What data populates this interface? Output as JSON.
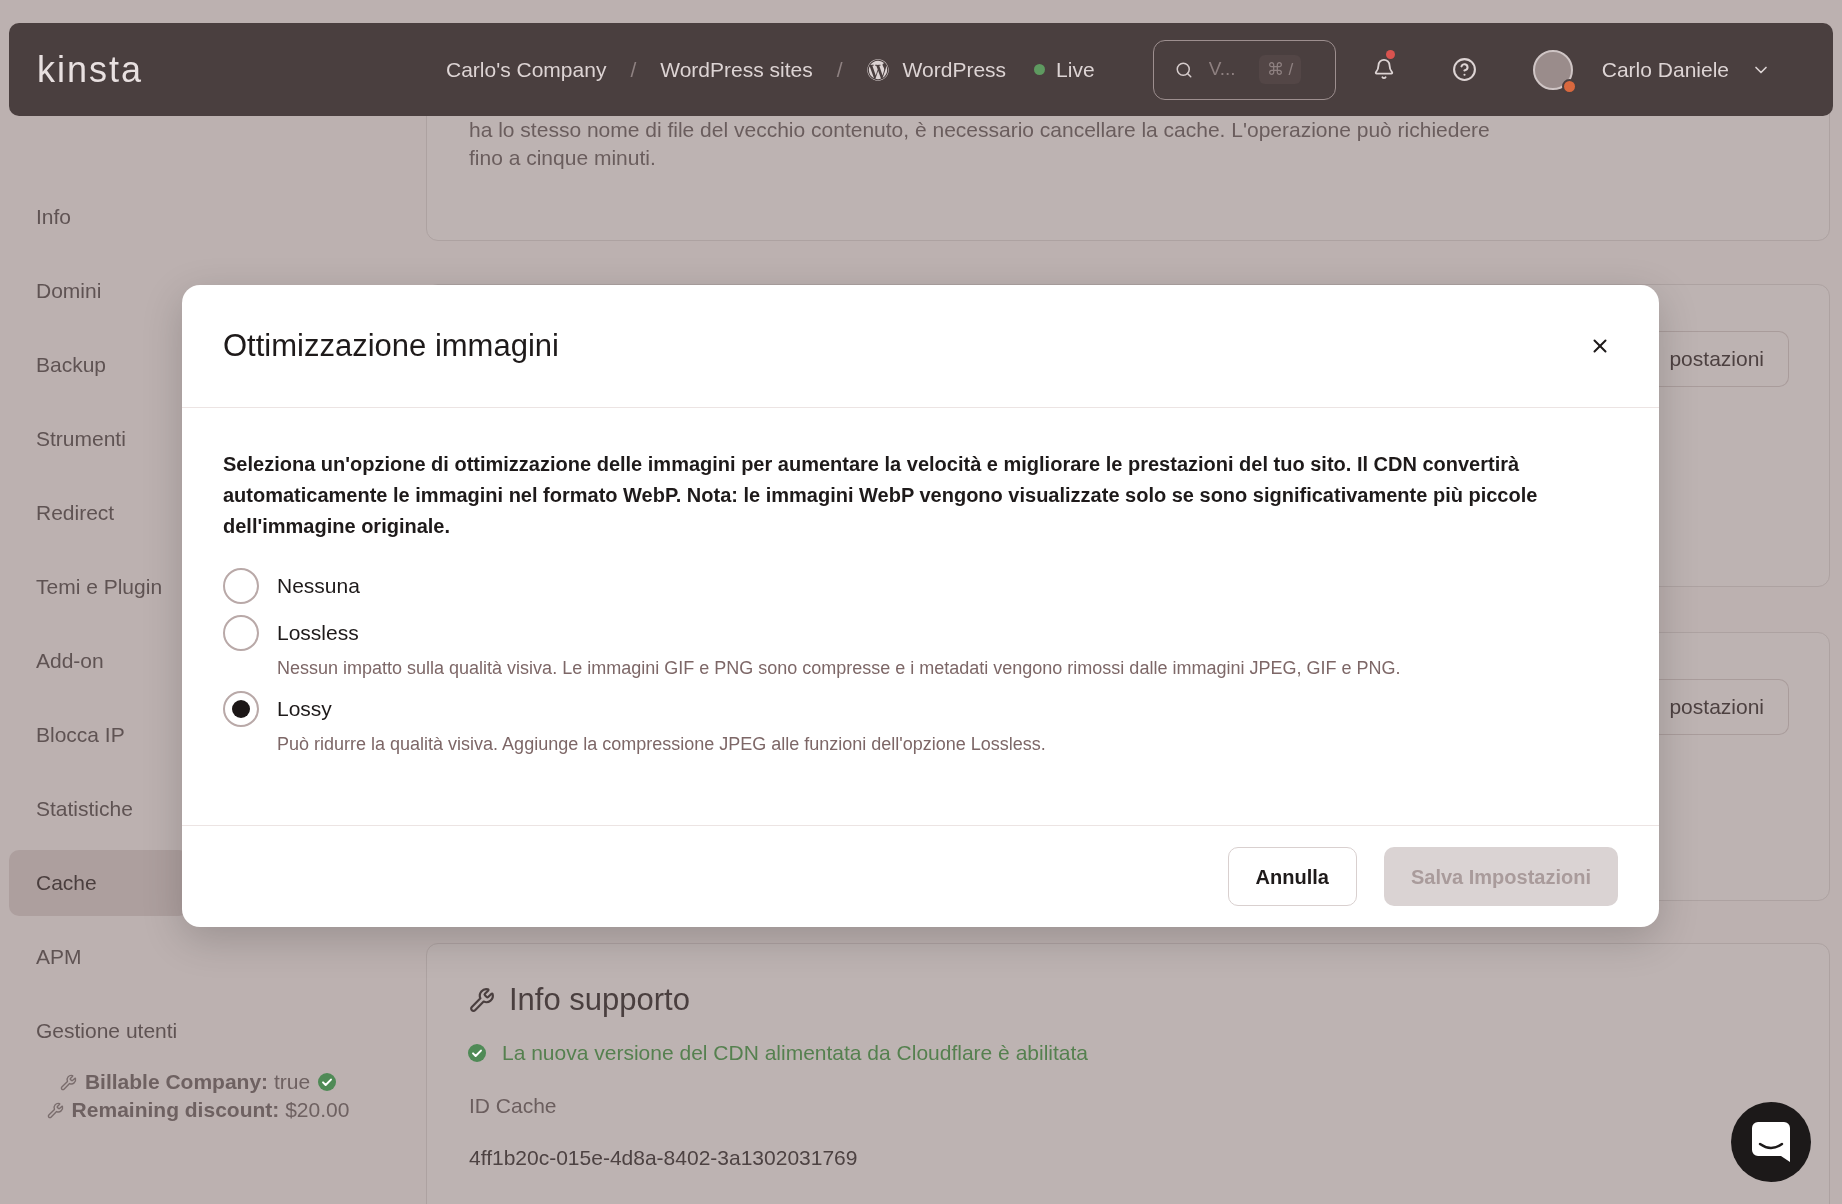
{
  "topbar": {
    "logo": "kinsta",
    "breadcrumbs": [
      {
        "kind": "link",
        "text": "Carlo's Company"
      },
      {
        "kind": "separator",
        "text": "/"
      },
      {
        "kind": "link",
        "text": "WordPress sites"
      },
      {
        "kind": "separator",
        "text": "/"
      },
      {
        "kind": "site",
        "text": "WordPress"
      }
    ],
    "status": {
      "label": "Live",
      "online": true
    },
    "search": {
      "placeholder": "V...",
      "shortcut": "⌘ /"
    },
    "notifications": {
      "unread": true
    },
    "user": {
      "name": "Carlo Daniele"
    }
  },
  "sidebar": {
    "items": [
      {
        "label": "Info",
        "selected": false
      },
      {
        "label": "Domini",
        "selected": false
      },
      {
        "label": "Backup",
        "selected": false
      },
      {
        "label": "Strumenti",
        "selected": false
      },
      {
        "label": "Redirect",
        "selected": false
      },
      {
        "label": "Temi e Plugin",
        "selected": false
      },
      {
        "label": "Add-on",
        "selected": false
      },
      {
        "label": "Blocca IP",
        "selected": false
      },
      {
        "label": "Statistiche",
        "selected": false
      },
      {
        "label": "Cache",
        "selected": true
      },
      {
        "label": "APM",
        "selected": false
      },
      {
        "label": "Gestione utenti",
        "selected": false
      }
    ],
    "meta": [
      {
        "text": "**Billable Company:** true",
        "verified": true
      },
      {
        "text": "**Remaining discount:** $20.00"
      }
    ]
  },
  "content": {
    "notice": {
      "lines": [
        "ha lo stesso nome di file del vecchio contenuto, è necessario cancellare la cache. L'operazione può richiedere",
        "fino a cinque minuti."
      ]
    },
    "setting_cards": [
      {
        "button": "postazioni"
      },
      {
        "button": "postazioni"
      }
    ],
    "support": {
      "title": "Info supporto",
      "cdn_status": {
        "text": "La nuova versione del CDN alimentata da Cloudflare è abilitata",
        "enabled": true
      },
      "fields": [
        {
          "label": "ID Cache",
          "value": "4ff1b20c-015e-4d8a-8402-3a1302031769"
        }
      ]
    }
  },
  "modal": {
    "title": "Ottimizzazione immagini",
    "description_lines": [
      "Seleziona un'opzione di ottimizzazione delle immagini per aumentare la velocità e migliorare le prestazioni del tuo sito. Il CDN convertirà",
      "automaticamente le immagini nel formato WebP. Nota: le immagini WebP vengono visualizzate solo se sono significativamente più piccole",
      "dell'immagine originale."
    ],
    "options": [
      {
        "label": "Nessuna",
        "selected": false
      },
      {
        "label": "Lossless",
        "description": "Nessun impatto sulla qualità visiva. Le immagini GIF e PNG sono compresse e i metadati vengono rimossi dalle immagini JPEG, GIF e PNG.",
        "selected": false
      },
      {
        "label": "Lossy",
        "description": "Può ridurre la qualità visiva. Aggiunge la compressione JPEG alle funzioni dell'opzione Lossless.",
        "selected": true
      }
    ],
    "buttons": [
      {
        "label": "Annulla",
        "kind": "secondary",
        "disabled": false
      },
      {
        "label": "Salva Impostazioni",
        "kind": "primary",
        "disabled": true
      }
    ]
  }
}
